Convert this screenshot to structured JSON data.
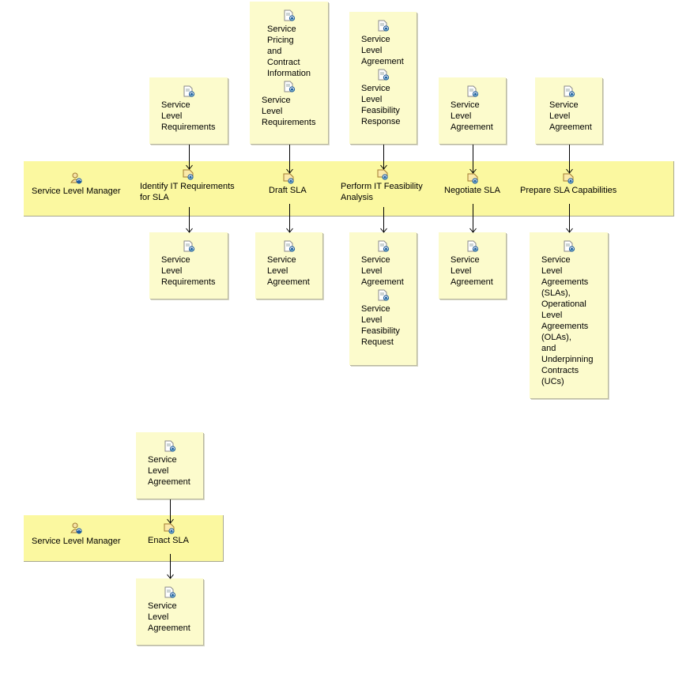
{
  "diagram": {
    "lanes": [
      {
        "role": "Service Level Manager",
        "activities": [
          "Identify IT Requirements\nfor SLA",
          "Draft SLA",
          "Perform IT Feasibility\nAnalysis",
          "Negotiate SLA",
          "Prepare SLA Capabilities"
        ]
      },
      {
        "role": "Service Level Manager",
        "activities": [
          "Enact SLA"
        ]
      }
    ],
    "inputs": [
      [
        "Service\nLevel\nRequirements"
      ],
      [
        "Service\nPricing\nand\nContract\nInformation",
        "Service\nLevel\nRequirements"
      ],
      [
        "Service\nLevel\nAgreement",
        "Service\nLevel\nFeasibility\nResponse"
      ],
      [
        "Service\nLevel\nAgreement"
      ],
      [
        "Service\nLevel\nAgreement"
      ],
      [
        "Service\nLevel\nAgreement"
      ]
    ],
    "outputs": [
      [
        "Service\nLevel\nRequirements"
      ],
      [
        "Service\nLevel\nAgreement"
      ],
      [
        "Service\nLevel\nAgreement",
        "Service\nLevel\nFeasibility\nRequest"
      ],
      [
        "Service\nLevel\nAgreement"
      ],
      [
        "Service\nLevel\nAgreements\n(SLAs),\nOperational\nLevel\nAgreements\n(OLAs),\nand\nUnderpinning\nContracts\n(UCs)"
      ],
      [
        "Service\nLevel\nAgreement"
      ]
    ],
    "colors": {
      "lane_fill": "#fbf8a0",
      "artifact_fill": "#fcfbcc",
      "icon_blue": "#1f5c9c"
    }
  }
}
